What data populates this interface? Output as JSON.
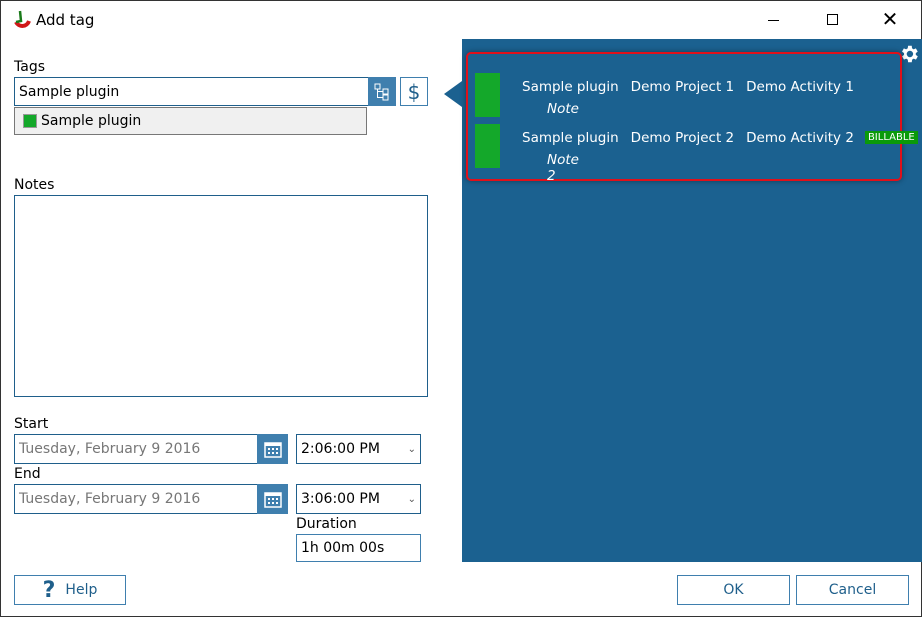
{
  "window": {
    "title": "Add tag",
    "minimize_icon": "minimize-icon",
    "maximize_icon": "maximize-icon",
    "close_icon": "close-icon"
  },
  "tags": {
    "label": "Tags",
    "value": "Sample plugin",
    "suggestion": "Sample plugin",
    "suggestion_color": "#14a82a"
  },
  "notes": {
    "label": "Notes",
    "value": ""
  },
  "start": {
    "label": "Start",
    "date": "Tuesday, February 9 2016",
    "time": "2:06:00 PM"
  },
  "end": {
    "label": "End",
    "date": "Tuesday, February 9 2016",
    "time": "3:06:00 PM"
  },
  "duration": {
    "label": "Duration",
    "value": "1h 00m 00s"
  },
  "buttons": {
    "help": "Help",
    "ok": "OK",
    "cancel": "Cancel",
    "dollar": "$"
  },
  "entries": [
    {
      "tag": "Sample plugin",
      "project": "Demo Project 1",
      "activity": "Demo Activity 1",
      "note": "Note",
      "badge": ""
    },
    {
      "tag": "Sample plugin",
      "project": "Demo Project 2",
      "activity": "Demo Activity 2",
      "note": "Note 2",
      "badge": "BILLABLE"
    }
  ],
  "colors": {
    "panel": "#1b6190",
    "accent": "#3f7fae",
    "tag_green": "#14a82a",
    "highlight_border": "#e0101a",
    "billable": "#0a9a0a"
  }
}
